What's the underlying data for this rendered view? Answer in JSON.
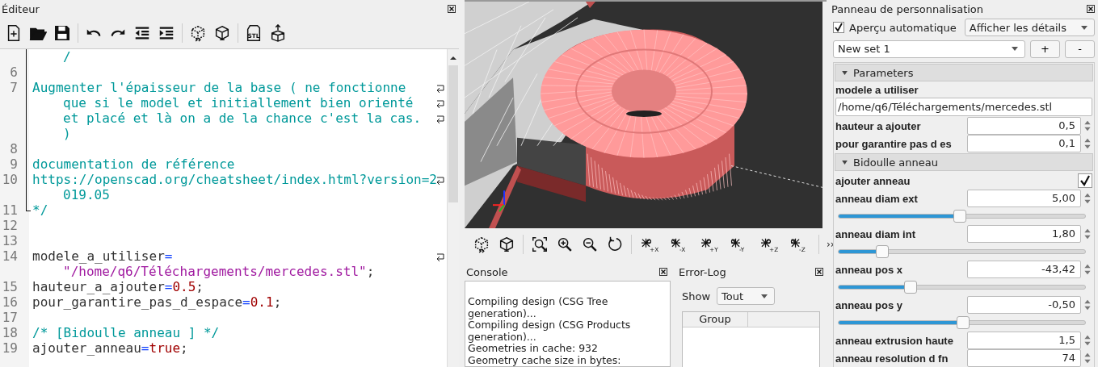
{
  "editor": {
    "title": "Éditeur",
    "stl_label": "STL",
    "lines": [
      {
        "in_fold": true,
        "segments": [
          {
            "kind": "comment",
            "text": "/"
          }
        ]
      },
      {
        "number": "6",
        "in_fold": true
      },
      {
        "number": "7",
        "wrap_marker": true,
        "in_fold": true,
        "segments": [
          {
            "kind": "comment",
            "text": "Augmenter l'épaisseur de la base ( ne fonctionne"
          }
        ]
      },
      {
        "wrap_marker": true,
        "in_fold": true,
        "segments": [
          {
            "kind": "comment",
            "text": "que si le model et initiallement bien orienté"
          }
        ]
      },
      {
        "wrap_marker": true,
        "in_fold": true,
        "segments": [
          {
            "kind": "comment",
            "text": "et placé et là on a de la chance c'est la cas."
          }
        ]
      },
      {
        "in_fold": true,
        "segments": [
          {
            "kind": "comment",
            "text": ")"
          }
        ]
      },
      {
        "number": "8",
        "in_fold": true
      },
      {
        "number": "9",
        "in_fold": true,
        "segments": [
          {
            "kind": "comment",
            "text": "documentation de référence"
          }
        ]
      },
      {
        "number": "10",
        "wrap_marker": true,
        "in_fold": true,
        "segments": [
          {
            "kind": "comment",
            "text": "https://openscad.org/cheatsheet/index.html?version=2"
          }
        ]
      },
      {
        "in_fold": true,
        "segments": [
          {
            "kind": "comment",
            "text": "019.05"
          }
        ]
      },
      {
        "number": "11",
        "fold_end": true,
        "segments": [
          {
            "kind": "comment",
            "text": "*/"
          }
        ]
      },
      {
        "number": "12"
      },
      {
        "number": "13"
      },
      {
        "number": "14",
        "wrap_marker": true,
        "segments": [
          {
            "kind": "ident",
            "text": "modele_a_utiliser"
          },
          {
            "kind": "op",
            "text": "="
          }
        ]
      },
      {
        "segments": [
          {
            "kind": "string",
            "text": "\"/home/q6/Téléchargements/mercedes.stl\""
          },
          {
            "kind": "ident",
            "text": ";"
          }
        ]
      },
      {
        "number": "15",
        "segments": [
          {
            "kind": "ident",
            "text": "hauteur_a_ajouter"
          },
          {
            "kind": "op",
            "text": "="
          },
          {
            "kind": "number",
            "text": "0.5"
          },
          {
            "kind": "ident",
            "text": ";"
          }
        ]
      },
      {
        "number": "16",
        "segments": [
          {
            "kind": "ident",
            "text": "pour_garantire_pas_d_espace"
          },
          {
            "kind": "op",
            "text": "="
          },
          {
            "kind": "number",
            "text": "0.1"
          },
          {
            "kind": "ident",
            "text": ";"
          }
        ]
      },
      {
        "number": "17"
      },
      {
        "number": "18",
        "segments": [
          {
            "kind": "comment",
            "text": "/* [Bidoulle anneau ] */"
          }
        ]
      },
      {
        "number": "19",
        "segments": [
          {
            "kind": "ident",
            "text": "ajouter_anneau"
          },
          {
            "kind": "op",
            "text": "="
          },
          {
            "kind": "number",
            "text": "true"
          },
          {
            "kind": "ident",
            "text": ";"
          }
        ]
      }
    ]
  },
  "viewport": {
    "view_labels": [
      "+X",
      "-X",
      "+Y",
      "-Y",
      "+Z",
      "-Z"
    ],
    "overflow": "››"
  },
  "console": {
    "title": "Console",
    "lines": [
      "Compiling design (CSG Tree generation)...",
      "Compiling design (CSG Products generation)...",
      "Geometries in cache: 932",
      "Geometry cache size in bytes:"
    ]
  },
  "error_log": {
    "title": "Error-Log",
    "show_label": "Show",
    "filter": "Tout",
    "columns": [
      "Group"
    ]
  },
  "customizer": {
    "title": "Panneau de personnalisation",
    "auto_preview": {
      "label": "Aperçu automatique",
      "checked": true
    },
    "details": "Afficher les détails",
    "preset": "New set 1",
    "buttons": [
      "+",
      "-"
    ],
    "groups": [
      {
        "title": "Parameters",
        "expanded": true,
        "params": [
          {
            "kind": "text",
            "label": "modele a utiliser",
            "value": "/home/q6/Téléchargements/mercedes.stl"
          },
          {
            "kind": "spin",
            "label": "hauteur a ajouter",
            "value": "0,5"
          },
          {
            "kind": "spin",
            "label": "pour garantire pas d es",
            "value": "0,1"
          }
        ]
      },
      {
        "title": "Bidoulle anneau",
        "expanded": true,
        "params": [
          {
            "kind": "checkbox",
            "label": "ajouter anneau",
            "checked": true
          },
          {
            "kind": "slider",
            "label": "anneau diam ext",
            "value": "5,00",
            "level": 0.49
          },
          {
            "kind": "slider",
            "label": "anneau diam int",
            "value": "1,80",
            "level": 0.175
          },
          {
            "kind": "slider",
            "label": "anneau pos x",
            "value": "-43,42",
            "level": 0.29
          },
          {
            "kind": "slider",
            "label": "anneau pos y",
            "value": "-0,50",
            "level": 0.5
          },
          {
            "kind": "spin",
            "label": "anneau extrusion haute",
            "value": "1,5"
          },
          {
            "kind": "spin",
            "label": "anneau resolution d fn",
            "value": "74"
          }
        ]
      }
    ]
  }
}
